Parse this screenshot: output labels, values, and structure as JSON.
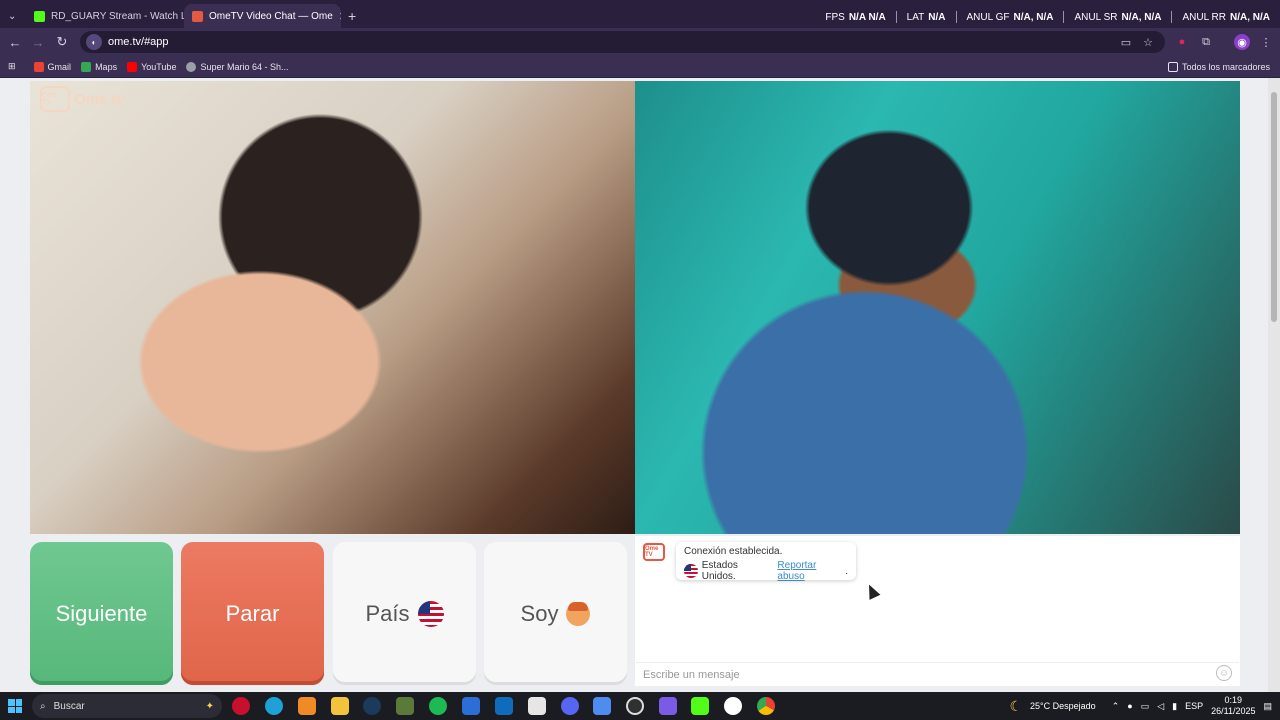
{
  "tabs": [
    {
      "label": "RD_GUARY Stream - Watch Live",
      "active": false,
      "favicon_color": "#53fc18"
    },
    {
      "label": "OmeTV Video Chat — Ome",
      "active": true,
      "favicon_color": "#e35a41"
    }
  ],
  "overlay_stats": [
    {
      "label": "FPS",
      "value": "N/A  N/A"
    },
    {
      "label": "LAT",
      "value": "N/A"
    },
    {
      "label": "ANUL GF",
      "value": "N/A, N/A"
    },
    {
      "label": "ANUL SR",
      "value": "N/A, N/A"
    },
    {
      "label": "ANUL RR",
      "value": "N/A, N/A"
    }
  ],
  "address": {
    "url": "ome.tv/#app"
  },
  "bookmarks": [
    {
      "label": "Gmail",
      "color": "#ea4335"
    },
    {
      "label": "Maps",
      "color": "#34a853"
    },
    {
      "label": "YouTube",
      "color": "#ff0000"
    },
    {
      "label": "Super Mario 64 - Sh...",
      "color": "#9aa0a6"
    }
  ],
  "bookmarks_all": "Todos los marcadores",
  "logo": {
    "text": "Ome.tv",
    "box": "Ome TV"
  },
  "buttons": {
    "next": "Siguiente",
    "stop": "Parar",
    "country": "País",
    "gender": "Soy"
  },
  "chat": {
    "logo": "Ome TV",
    "status": "Conexión establecida.",
    "country": "Estados Unidos.",
    "report": "Reportar abuso",
    "report_suffix": ".",
    "placeholder": "Escribe un mensaje"
  },
  "taskbar": {
    "search": "Buscar",
    "weather": "25°C  Despejado",
    "lang": "ESP",
    "time": "0:19",
    "date": "26/11/2025"
  },
  "colors": {
    "next": "#5fbf83",
    "stop": "#e5704f",
    "accent": "#e35a41"
  }
}
